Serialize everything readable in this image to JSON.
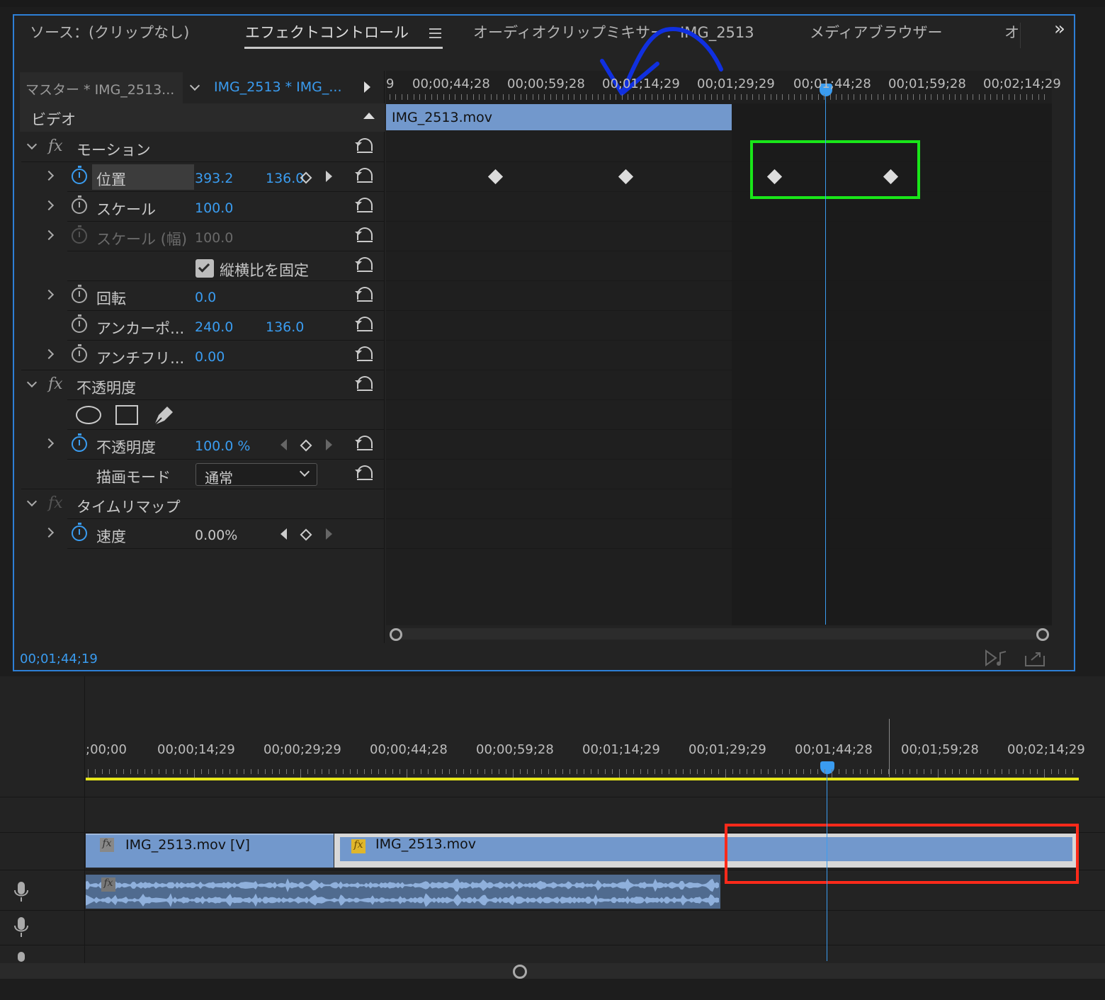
{
  "tabs": {
    "source": "ソース：(クリップなし)",
    "effect_controls": "エフェクトコントロール",
    "audio_mixer": "オーディオクリップミキサー：IMG_2513",
    "media_browser": "メディアブラウザー",
    "more": "オ",
    "overflow": "»"
  },
  "clip_selector": {
    "master": "マスター * IMG_2513...",
    "clip": "IMG_2513 * IMG_..."
  },
  "section": {
    "video": "ビデオ"
  },
  "effects": {
    "motion": {
      "name": "モーション",
      "position": {
        "label": "位置",
        "x": "393.2",
        "y": "136.0"
      },
      "scale": {
        "label": "スケール",
        "value": "100.0"
      },
      "scale_width": {
        "label": "スケール (幅)",
        "value": "100.0"
      },
      "uniform_scale": {
        "label": "縦横比を固定",
        "checked": true
      },
      "rotation": {
        "label": "回転",
        "value": "0.0"
      },
      "anchor": {
        "label": "アンカーポ...",
        "x": "240.0",
        "y": "136.0"
      },
      "antiflicker": {
        "label": "アンチフリ...",
        "value": "0.00"
      }
    },
    "opacity": {
      "name": "不透明度",
      "opacity": {
        "label": "不透明度",
        "value": "100.0 %"
      },
      "blend": {
        "label": "描画モード",
        "value": "通常"
      }
    },
    "time_remap": {
      "name": "タイムリマップ",
      "speed": {
        "label": "速度",
        "value": "0.00%"
      }
    }
  },
  "ec_timeline": {
    "clip_name": "IMG_2513.mov",
    "ruler": [
      "9",
      "00;00;44;28",
      "00;00;59;28",
      "00;01;14;29",
      "00;01;29;29",
      "00;01;44;28",
      "00;01;59;28",
      "00;02;14;29"
    ]
  },
  "ec_timecode": "00;01;44;19",
  "sequence": {
    "ruler": [
      ";00;00",
      "00;00;14;29",
      "00;00;29;29",
      "00;00;44;28",
      "00;00;59;28",
      "00;01;14;29",
      "00;01;29;29",
      "00;01;44;28",
      "00;01;59;28",
      "00;02;14;29"
    ],
    "clip_v1": "IMG_2513.mov [V]",
    "clip_v2": "IMG_2513.mov",
    "fx_badge": "fx"
  },
  "colors": {
    "accent": "#3a9cf0",
    "clip": "#7298cc",
    "annotation_green": "#19e619",
    "annotation_red": "#ff2a1a",
    "annotation_blue": "#1030e0",
    "work_area": "#e6e61a"
  }
}
